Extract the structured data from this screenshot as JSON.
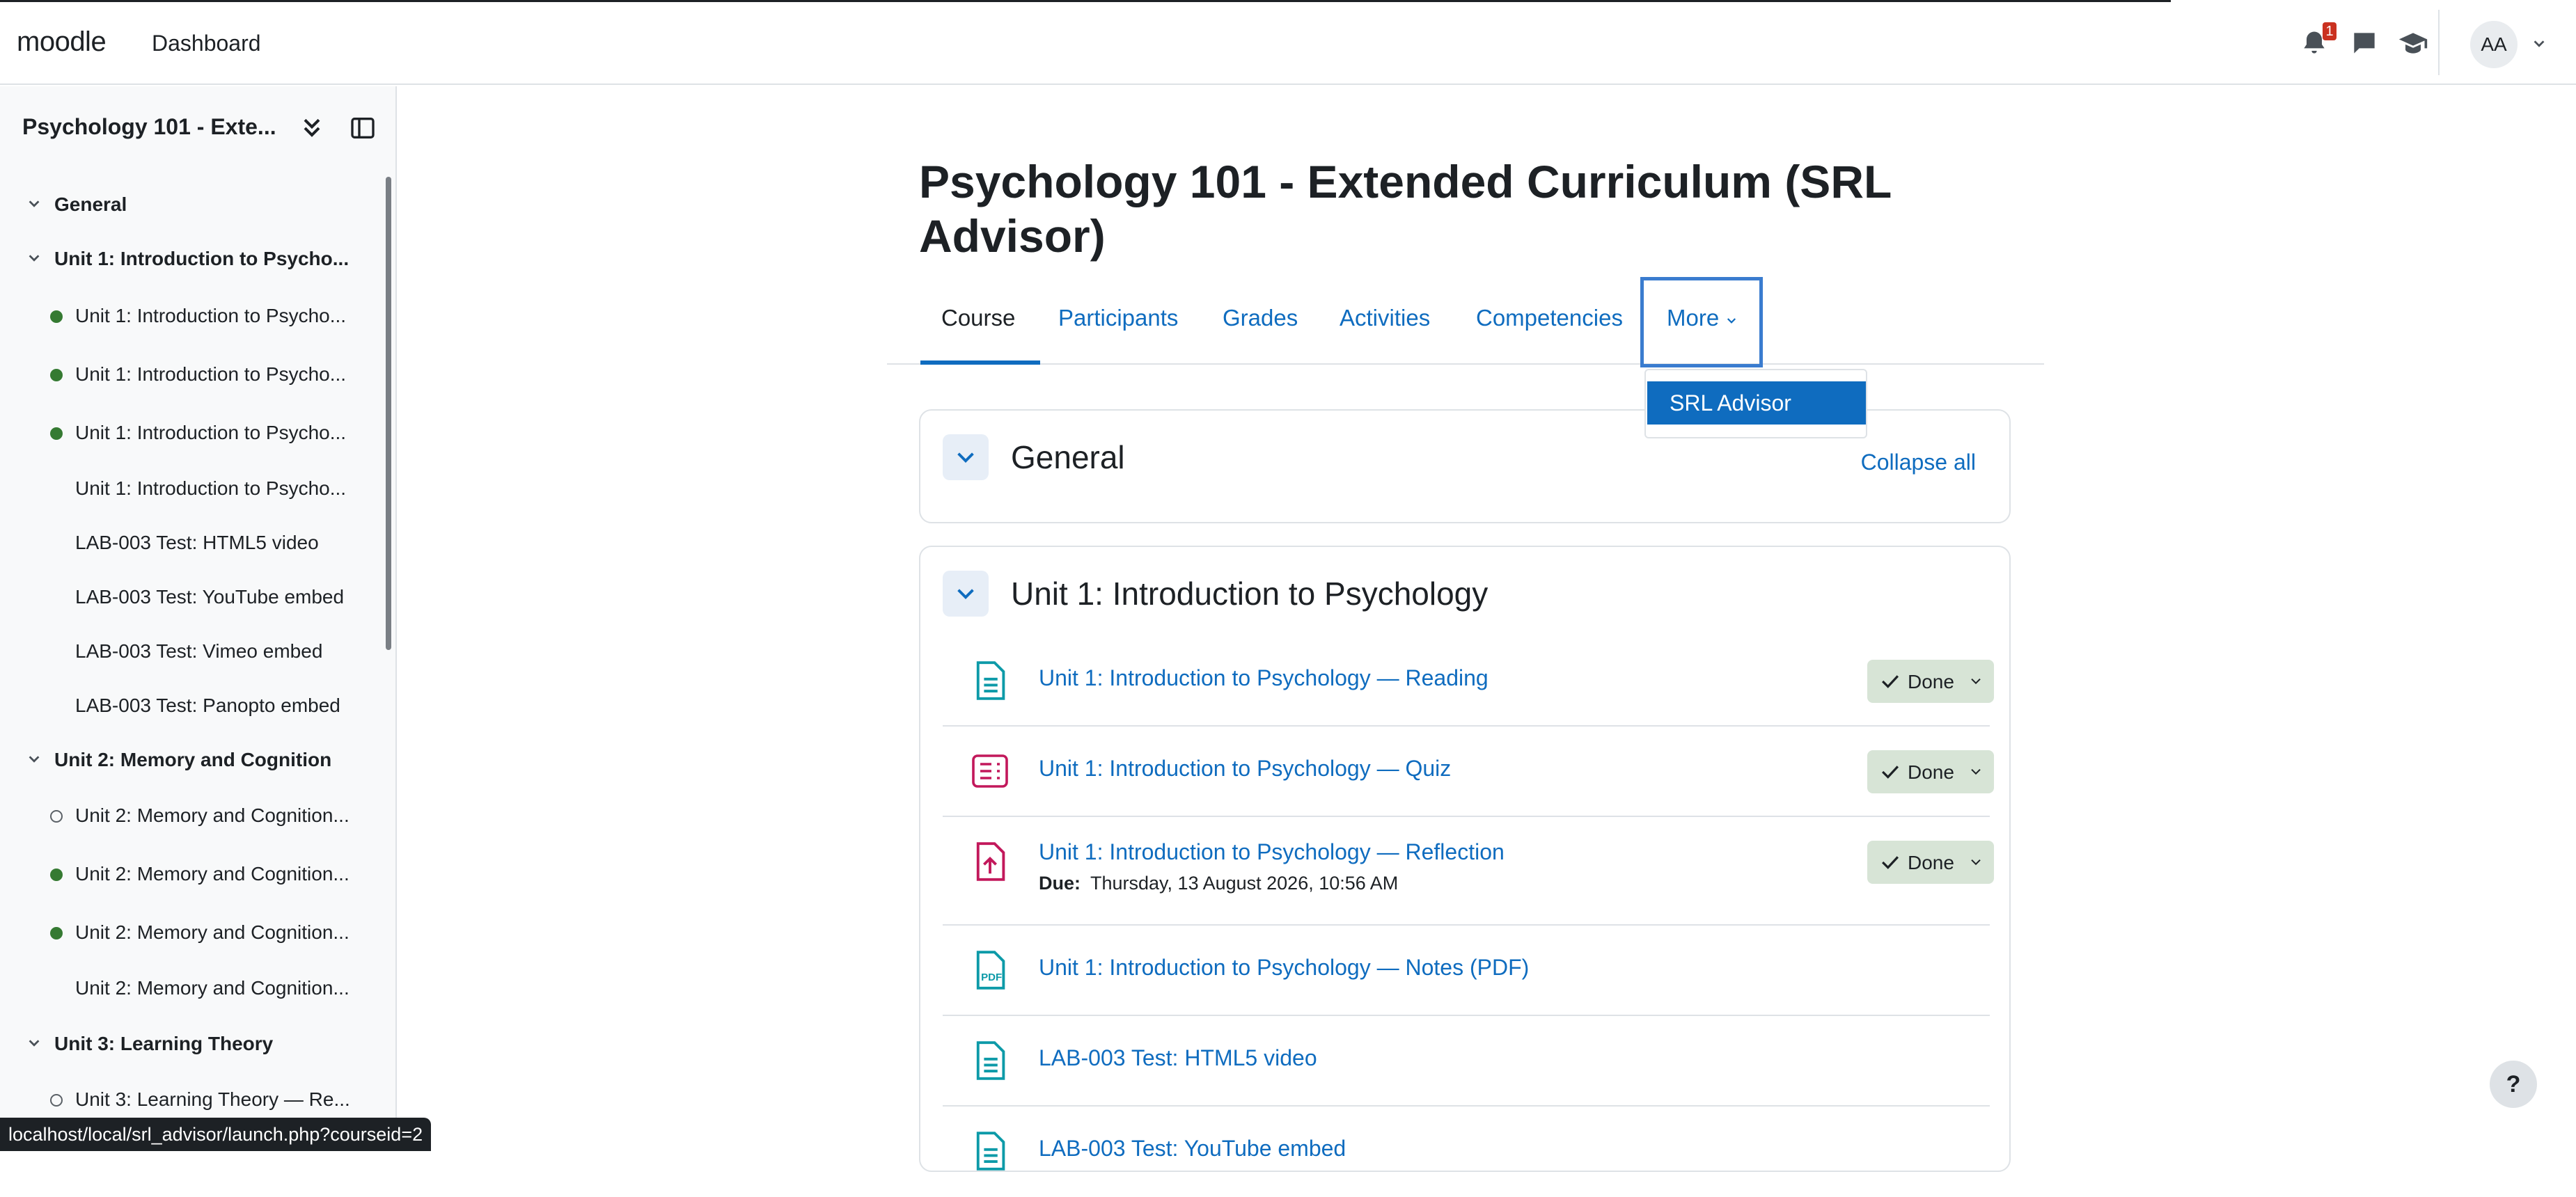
{
  "topbar": {
    "brand": "moodle",
    "nav_dashboard": "Dashboard",
    "notification_count": "1",
    "avatar_initials": "AA"
  },
  "sidebar": {
    "course_title": "Psychology 101 - Exte...",
    "items": [
      {
        "kind": "section",
        "label": "General"
      },
      {
        "kind": "section",
        "label": "Unit 1: Introduction to Psycho..."
      },
      {
        "kind": "activity",
        "status": "done",
        "label": "Unit 1: Introduction to Psycho..."
      },
      {
        "kind": "activity",
        "status": "done",
        "label": "Unit 1: Introduction to Psycho..."
      },
      {
        "kind": "activity",
        "status": "done",
        "label": "Unit 1: Introduction to Psycho..."
      },
      {
        "kind": "activity",
        "status": "none",
        "label": "Unit 1: Introduction to Psycho..."
      },
      {
        "kind": "activity",
        "status": "none",
        "label": "LAB-003 Test: HTML5 video"
      },
      {
        "kind": "activity",
        "status": "none",
        "label": "LAB-003 Test: YouTube embed"
      },
      {
        "kind": "activity",
        "status": "none",
        "label": "LAB-003 Test: Vimeo embed"
      },
      {
        "kind": "activity",
        "status": "none",
        "label": "LAB-003 Test: Panopto embed"
      },
      {
        "kind": "section",
        "label": "Unit 2: Memory and Cognition"
      },
      {
        "kind": "activity",
        "status": "todo",
        "label": "Unit 2: Memory and Cognition..."
      },
      {
        "kind": "activity",
        "status": "done",
        "label": "Unit 2: Memory and Cognition..."
      },
      {
        "kind": "activity",
        "status": "done",
        "label": "Unit 2: Memory and Cognition..."
      },
      {
        "kind": "activity",
        "status": "none",
        "label": "Unit 2: Memory and Cognition..."
      },
      {
        "kind": "section",
        "label": "Unit 3: Learning Theory"
      },
      {
        "kind": "activity",
        "status": "todo",
        "label": "Unit 3: Learning Theory — Re..."
      }
    ]
  },
  "main": {
    "page_title": "Psychology 101 - Extended Curriculum (SRL Advisor)",
    "tabs": [
      "Course",
      "Participants",
      "Grades",
      "Activities",
      "Competencies",
      "More"
    ],
    "more_menu_items": [
      "SRL Advisor"
    ],
    "general_section": {
      "title": "General",
      "collapse_all": "Collapse all"
    },
    "unit1": {
      "title": "Unit 1: Introduction to Psychology",
      "activities": [
        {
          "icon": "page-icon",
          "label": "Unit 1: Introduction to Psychology — Reading",
          "completion": "Done"
        },
        {
          "icon": "quiz-icon",
          "label": "Unit 1: Introduction to Psychology — Quiz",
          "completion": "Done"
        },
        {
          "icon": "assignment-icon",
          "label": "Unit 1: Introduction to Psychology — Reflection",
          "completion": "Done",
          "due_label": "Due:",
          "due_value": "Thursday, 13 August 2026, 10:56 AM"
        },
        {
          "icon": "pdf-icon",
          "label": "Unit 1: Introduction to Psychology — Notes (PDF)"
        },
        {
          "icon": "page-icon",
          "label": "LAB-003 Test: HTML5 video"
        },
        {
          "icon": "page-icon",
          "label": "LAB-003 Test: YouTube embed"
        }
      ]
    }
  },
  "status_bar_url": "localhost/local/srl_advisor/launch.php?courseid=2",
  "help_label": "?",
  "colors": {
    "link": "#0f6cbf",
    "done_green": "#357a32",
    "done_bg": "#d7e4d6",
    "quiz_pink": "#c2185b",
    "page_teal": "#0d9aa8"
  }
}
